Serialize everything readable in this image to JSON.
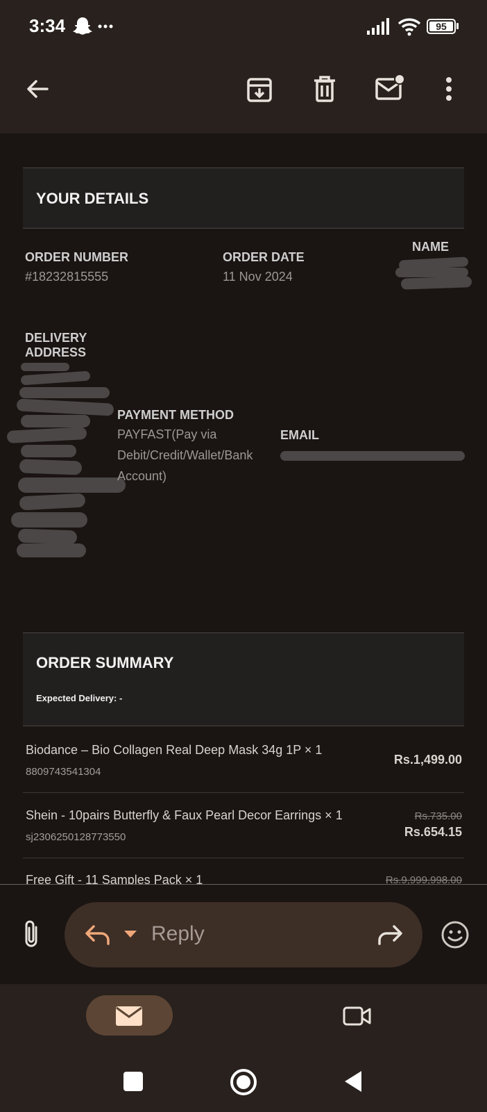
{
  "status_bar": {
    "time": "3:34",
    "battery": "95"
  },
  "toolbar": {
    "back_icon": "arrow-left-icon",
    "archive_icon": "archive-icon",
    "delete_icon": "trash-icon",
    "unread_icon": "mail-unread-icon",
    "more_icon": "more-vert-icon"
  },
  "details": {
    "section_title": "YOUR DETAILS",
    "order_number_label": "ORDER NUMBER",
    "order_number_value": "#18232815555",
    "order_date_label": "ORDER DATE",
    "order_date_value": "11 Nov 2024",
    "name_label": "NAME",
    "delivery_label_line1": "DELIVERY",
    "delivery_label_line2": "ADDRESS",
    "payment_label": "PAYMENT METHOD",
    "payment_line1": "PAYFAST(Pay via",
    "payment_line2": "Debit/Credit/Wallet/Bank",
    "payment_line3": "Account)",
    "email_label": "EMAIL"
  },
  "summary": {
    "section_title": "ORDER SUMMARY",
    "expected_delivery": "Expected Delivery: -",
    "items": [
      {
        "name": "Biodance – Bio Collagen Real Deep Mask 34g 1P × 1",
        "sku": "8809743541304",
        "price": "Rs.1,499.00",
        "original_price": ""
      },
      {
        "name": "Shein - 10pairs Butterfly & Faux Pearl Decor Earrings × 1",
        "sku": "sj2306250128773550",
        "price": "Rs.654.15",
        "original_price": "Rs.735.00"
      },
      {
        "name": "Free Gift - 11 Samples Pack × 1",
        "sku": "",
        "price": "",
        "original_price": "Rs.9,999,998.00"
      }
    ]
  },
  "reply_bar": {
    "attach_icon": "paperclip-icon",
    "reply_icon": "reply-icon",
    "dropdown_icon": "caret-down-icon",
    "reply_label": "Reply",
    "forward_icon": "forward-icon",
    "emoji_icon": "emoji-icon"
  },
  "bottom_nav": {
    "mail_icon": "mail-icon",
    "meet_icon": "video-camera-icon"
  },
  "system_nav": {
    "recents_icon": "square-icon",
    "home_icon": "circle-home-icon",
    "back_icon": "triangle-back-icon"
  }
}
